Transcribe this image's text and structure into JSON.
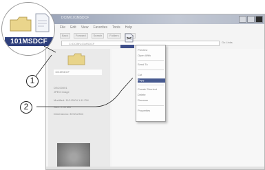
{
  "window": {
    "title": "DCIM\\101MSDCF",
    "menu": [
      "File",
      "Edit",
      "View",
      "Favorites",
      "Tools",
      "Help"
    ],
    "toolbar": [
      "Back",
      "Forward",
      "Search",
      "Folders",
      "Views"
    ],
    "address": "C:\\DCIM\\101MSDCF",
    "go_label": "Go  Links"
  },
  "left_pane": {
    "folder_name": "101MSDCF",
    "lines": [
      "DSC00001",
      "JPEG Image",
      "Modified: 11/1/2004 1:11 PM",
      "Size: 2.00 MB",
      "Dimensions: 3072x2304"
    ]
  },
  "context_menu": {
    "items": [
      "Preview",
      "Open With",
      "Send To",
      "Cut",
      "Copy",
      "Create Shortcut",
      "Delete",
      "Rename",
      "Properties"
    ],
    "highlighted_index": 4
  },
  "zoom": {
    "label": "101MSDCF"
  },
  "callouts": [
    "1",
    "2"
  ],
  "colors": {
    "highlight": "#46598f",
    "label_bg": "#2e3f7c"
  }
}
